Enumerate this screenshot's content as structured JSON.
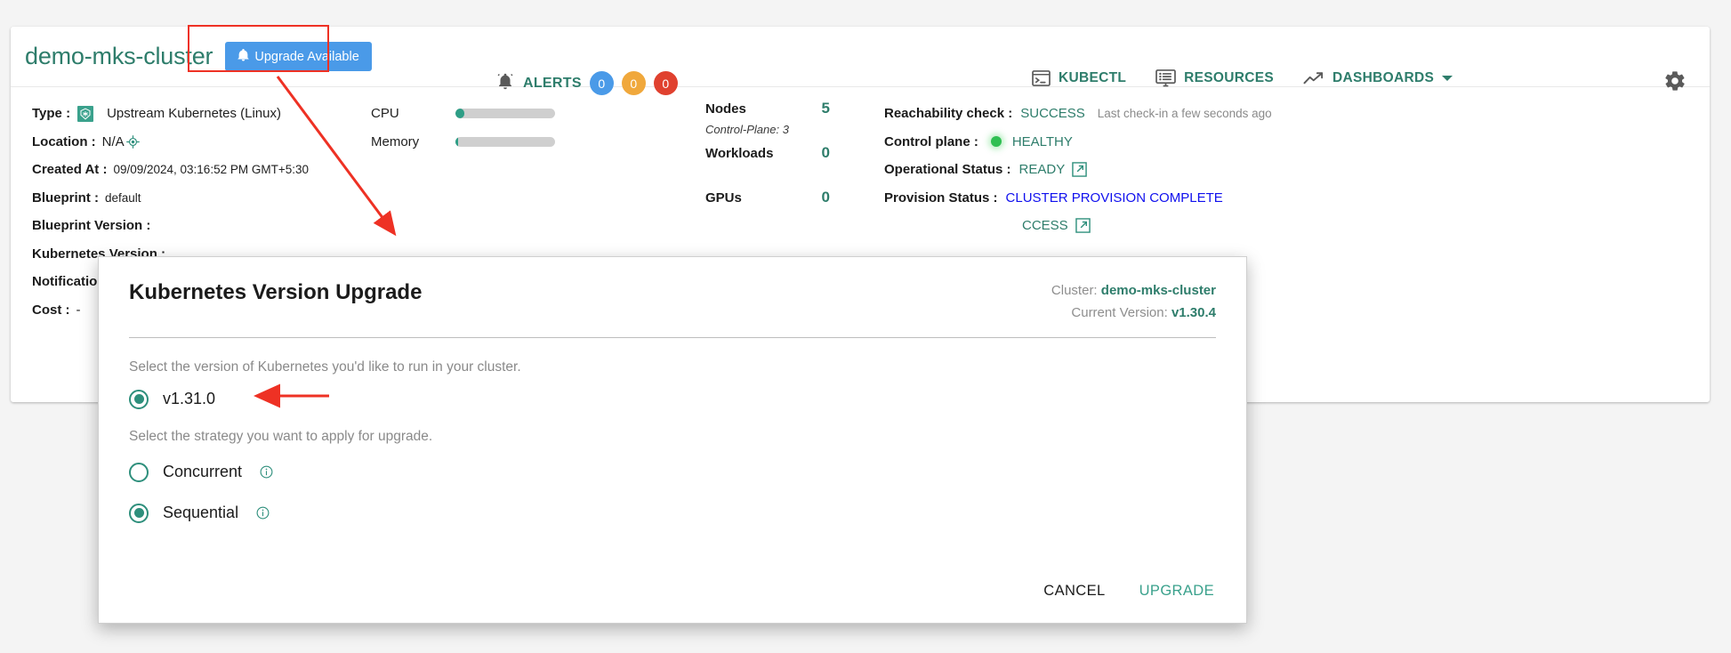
{
  "header": {
    "cluster_name": "demo-mks-cluster",
    "upgrade_available_label": "Upgrade Available",
    "alerts_label": "ALERTS",
    "alert_counts": {
      "info": "0",
      "warning": "0",
      "critical": "0"
    },
    "actions": [
      {
        "label": "KUBECTL",
        "icon": "terminal-icon"
      },
      {
        "label": "RESOURCES",
        "icon": "monitor-list-icon"
      },
      {
        "label": "DASHBOARDS",
        "icon": "trend-up-icon",
        "caret": true
      }
    ],
    "settings_icon": "gear-icon"
  },
  "info": {
    "rows": [
      {
        "key": "Type :",
        "value": "Upstream Kubernetes (Linux)",
        "icon": "kubernetes-logo-icon"
      },
      {
        "key": "Location :",
        "value": "N/A",
        "icon": "location-target-icon"
      },
      {
        "key": "Created At :",
        "value": "09/09/2024, 03:16:52 PM GMT+5:30"
      },
      {
        "key": "Blueprint :",
        "value": "default"
      },
      {
        "key": "Blueprint Version :",
        "value": ""
      },
      {
        "key": "Kubernetes Version :",
        "value": ""
      },
      {
        "key": "Notification :",
        "value": ""
      },
      {
        "key": "Cost :",
        "value": "-"
      }
    ]
  },
  "usage": {
    "rows": [
      {
        "label": "CPU",
        "percent": 9
      },
      {
        "label": "Memory",
        "percent": 3
      }
    ]
  },
  "counts": {
    "rows": [
      {
        "label": "Nodes",
        "value": "5",
        "sub": "Control-Plane: 3"
      },
      {
        "label": "Workloads",
        "value": "0",
        "sub": ""
      },
      {
        "label": "GPUs",
        "value": "0",
        "sub": ""
      }
    ]
  },
  "status": {
    "reachability_key": "Reachability check :",
    "reachability_value": "SUCCESS",
    "reachability_note": "Last check-in  a few seconds ago",
    "control_plane_key": "Control plane :",
    "control_plane_value": "HEALTHY",
    "operational_key": "Operational Status :",
    "operational_value": "READY",
    "provision_key": "Provision Status :",
    "provision_value": "CLUSTER PROVISION COMPLETE",
    "fourth_value": "CCESS"
  },
  "dialog": {
    "title": "Kubernetes Version Upgrade",
    "cluster_meta_label": "Cluster:",
    "cluster_meta_value": "demo-mks-cluster",
    "version_meta_label": "Current Version:",
    "version_meta_value": "v1.30.4",
    "version_help": "Select the version of Kubernetes you'd like to run in your cluster.",
    "version_option": {
      "label": "v1.31.0",
      "selected": true
    },
    "strategy_help": "Select the strategy you want to apply for upgrade.",
    "strategy_options": [
      {
        "label": "Concurrent",
        "selected": false,
        "info_icon": "info-circle-icon"
      },
      {
        "label": "Sequential",
        "selected": true,
        "info_icon": "info-circle-icon"
      }
    ],
    "cancel_label": "CANCEL",
    "upgrade_label": "UPGRADE"
  },
  "colors": {
    "brand_teal": "#2e7d6b",
    "accent_blue": "#4a9ae8",
    "annotation_red": "#ee3124",
    "healthy_green": "#2fbf52",
    "link_blue": "#1010ee"
  }
}
